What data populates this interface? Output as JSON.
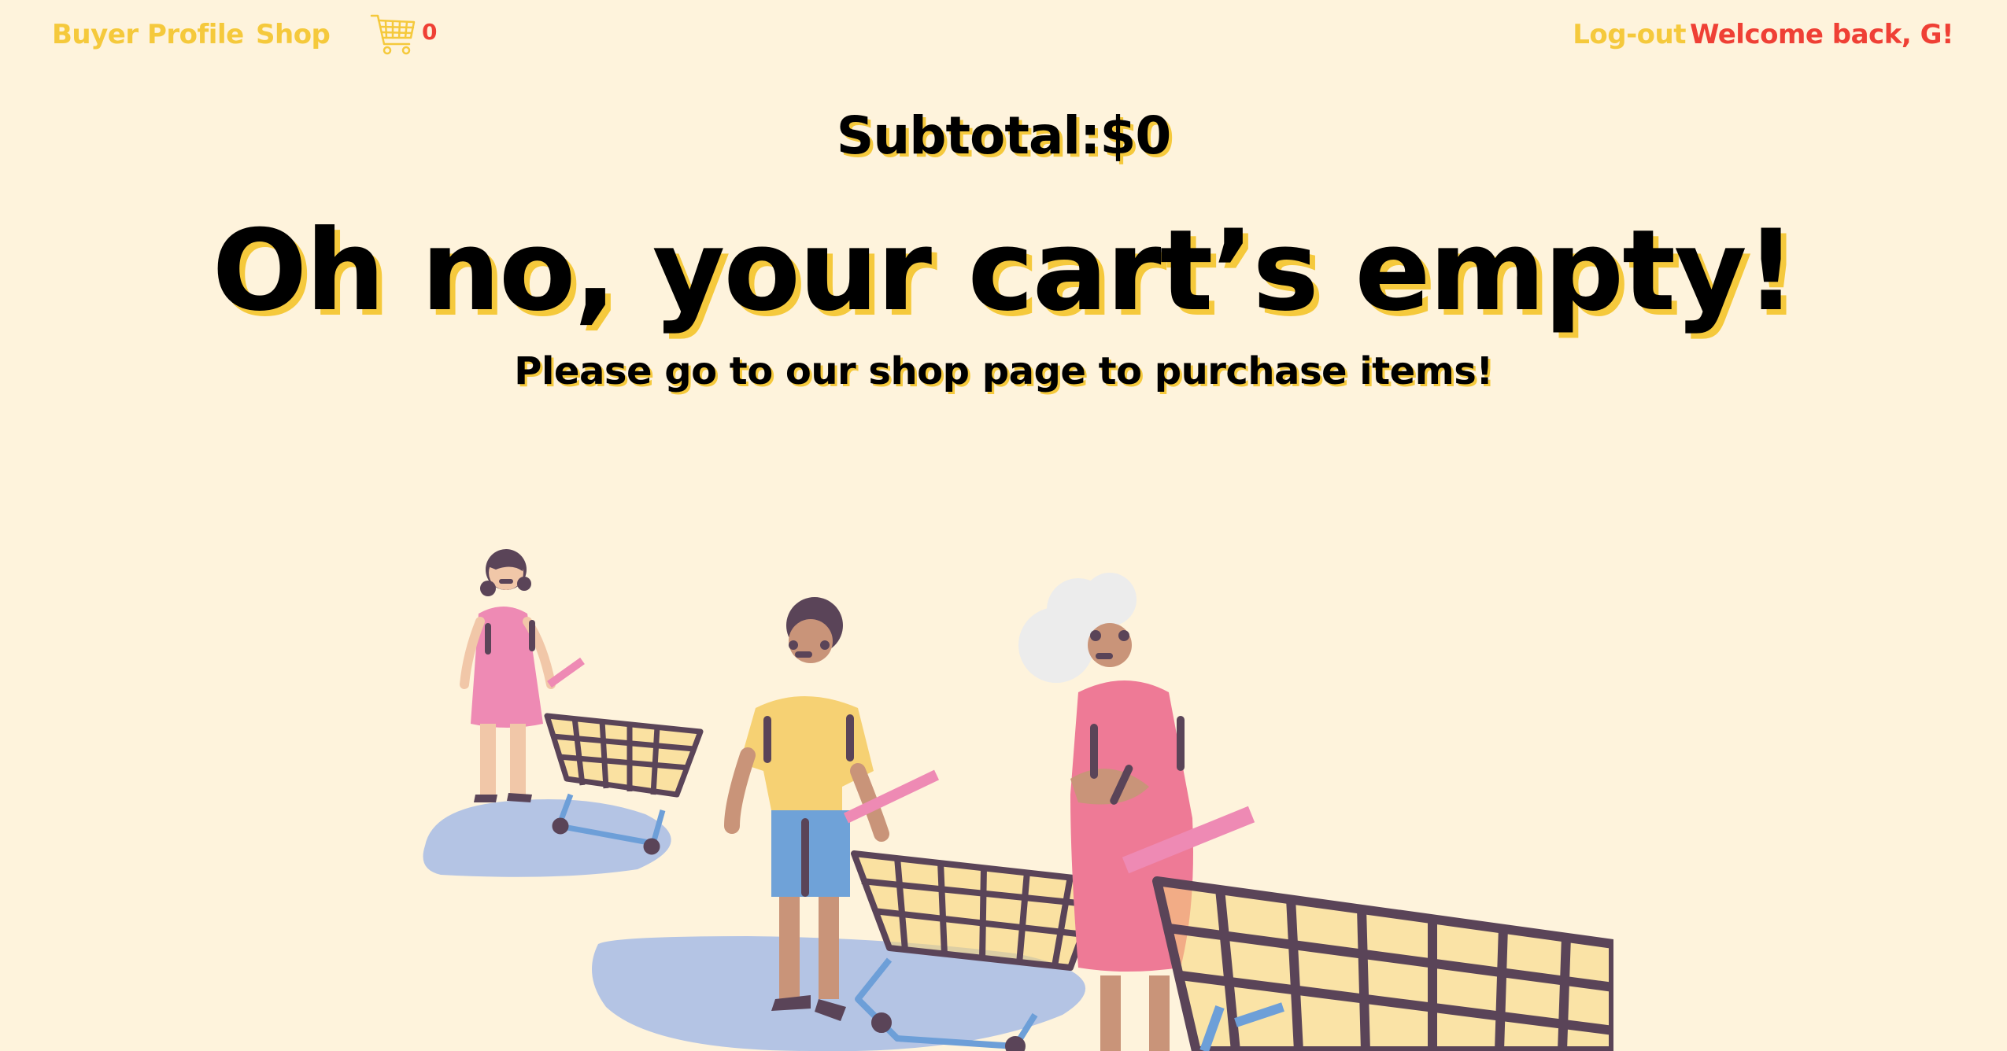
{
  "nav": {
    "buyer_profile": "Buyer Profile",
    "shop": "Shop",
    "cart_count": "0",
    "logout": "Log-out",
    "welcome": "Welcome back, G!",
    "cart_icon": "shopping-cart-icon"
  },
  "cart": {
    "subtotal": "Subtotal:$0",
    "empty_title": "Oh no, your cart’s empty!",
    "empty_message": "Please go to our shop page to purchase items!"
  },
  "colors": {
    "background": "#fef3dc",
    "accent_yellow": "#f5c93c",
    "accent_red": "#ef4035",
    "text": "#000000"
  },
  "illustration": "shoppers-with-carts-illustration"
}
